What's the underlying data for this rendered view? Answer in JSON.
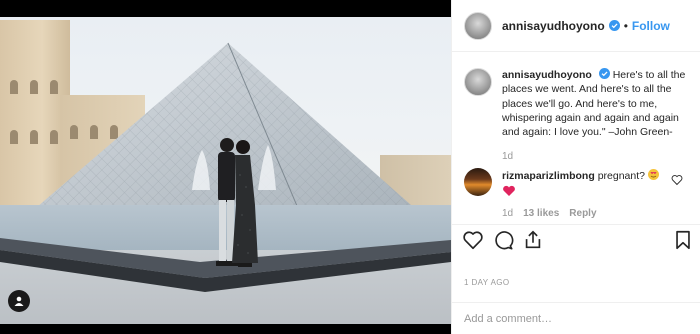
{
  "post": {
    "username": "annisayudhoyono",
    "follow_label": "Follow",
    "separator": "•",
    "caption_username": "annisayudhoyono",
    "caption_text": "Here's to all the places we went. And here's to all the places we'll go. And here's to me, whispering again and again and again and again: I love you.\" –John Green-",
    "caption_time": "1d",
    "comment": {
      "username": "rizmaparizlimbong",
      "text": "pregnant?",
      "time": "1d",
      "likes": "13 likes",
      "reply_label": "Reply"
    },
    "date": "1 DAY AGO",
    "add_comment_placeholder": "Add a comment…"
  },
  "icons": [
    "verified-icon",
    "heart-icon",
    "comment-icon",
    "share-icon",
    "bookmark-icon",
    "user-tag-icon"
  ],
  "colors": {
    "accent": "#3897f0",
    "emoji_heart": "#e0245e"
  }
}
